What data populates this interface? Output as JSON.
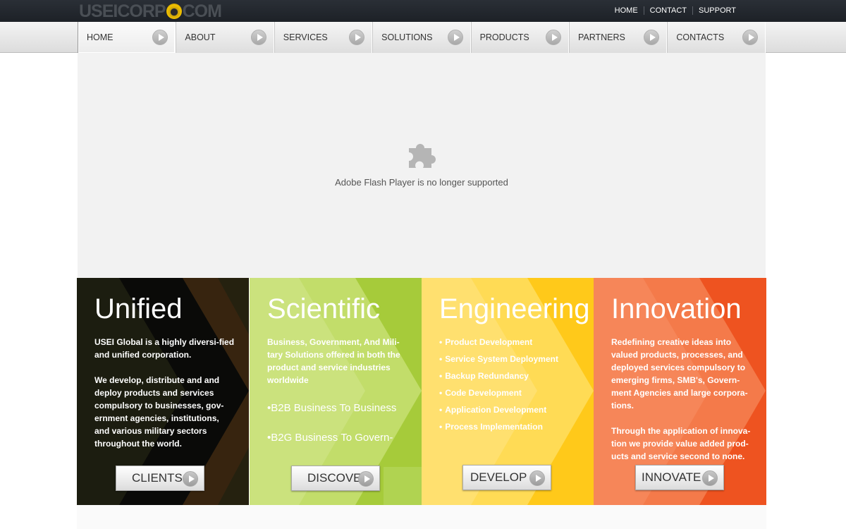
{
  "logo": {
    "text_left": "USEICORP",
    "text_right": "COM"
  },
  "top_links": [
    "HOME",
    "CONTACT",
    "SUPPORT"
  ],
  "nav": [
    "HOME",
    "ABOUT",
    "SERVICES",
    "SOLUTIONS",
    "PRODUCTS",
    "PARTNERS",
    "CONTACTS"
  ],
  "flash": {
    "message": "Adobe Flash Player is no longer supported"
  },
  "panels": {
    "unified": {
      "title": "Unified",
      "p1": "USEI Global is a highly diversi-fied and unified corporation.",
      "p2": "We develop, distribute and and deploy products and services compulsory to businesses, gov-ernment agencies, institutions, and various military sectors throughout the world.",
      "button": "CLIENTS"
    },
    "scientific": {
      "title": "Scientific",
      "p1": "Business, Government, And Mili-tary Solutions offered in both the product and service industries worldwide",
      "big1": "•B2B Business To Business",
      "big2": "•B2G Business To Govern-",
      "button": "DISCOVER"
    },
    "engineering": {
      "title": "Engineering",
      "items": [
        "Product Development",
        "Service System Deployment",
        "Backup Redundancy",
        "Code Development",
        "Application Development",
        "Process Implementation"
      ],
      "button": "DEVELOP"
    },
    "innovation": {
      "title": "Innovation",
      "p1": "Redefining creative ideas into valued  products, processes, and deployed services compulsory to emerging firms, SMB's, Govern-ment Agencies and large corpora-tions.",
      "p2": "Through the application of innova-tion we provide value added prod-ucts and service second to none.",
      "button": "INNOVATE"
    }
  },
  "colors": {
    "unified": "#1f1f12",
    "scientific": "#a9cd3c",
    "engineering": "#ffcc1a",
    "innovation": "#ef5a24"
  }
}
